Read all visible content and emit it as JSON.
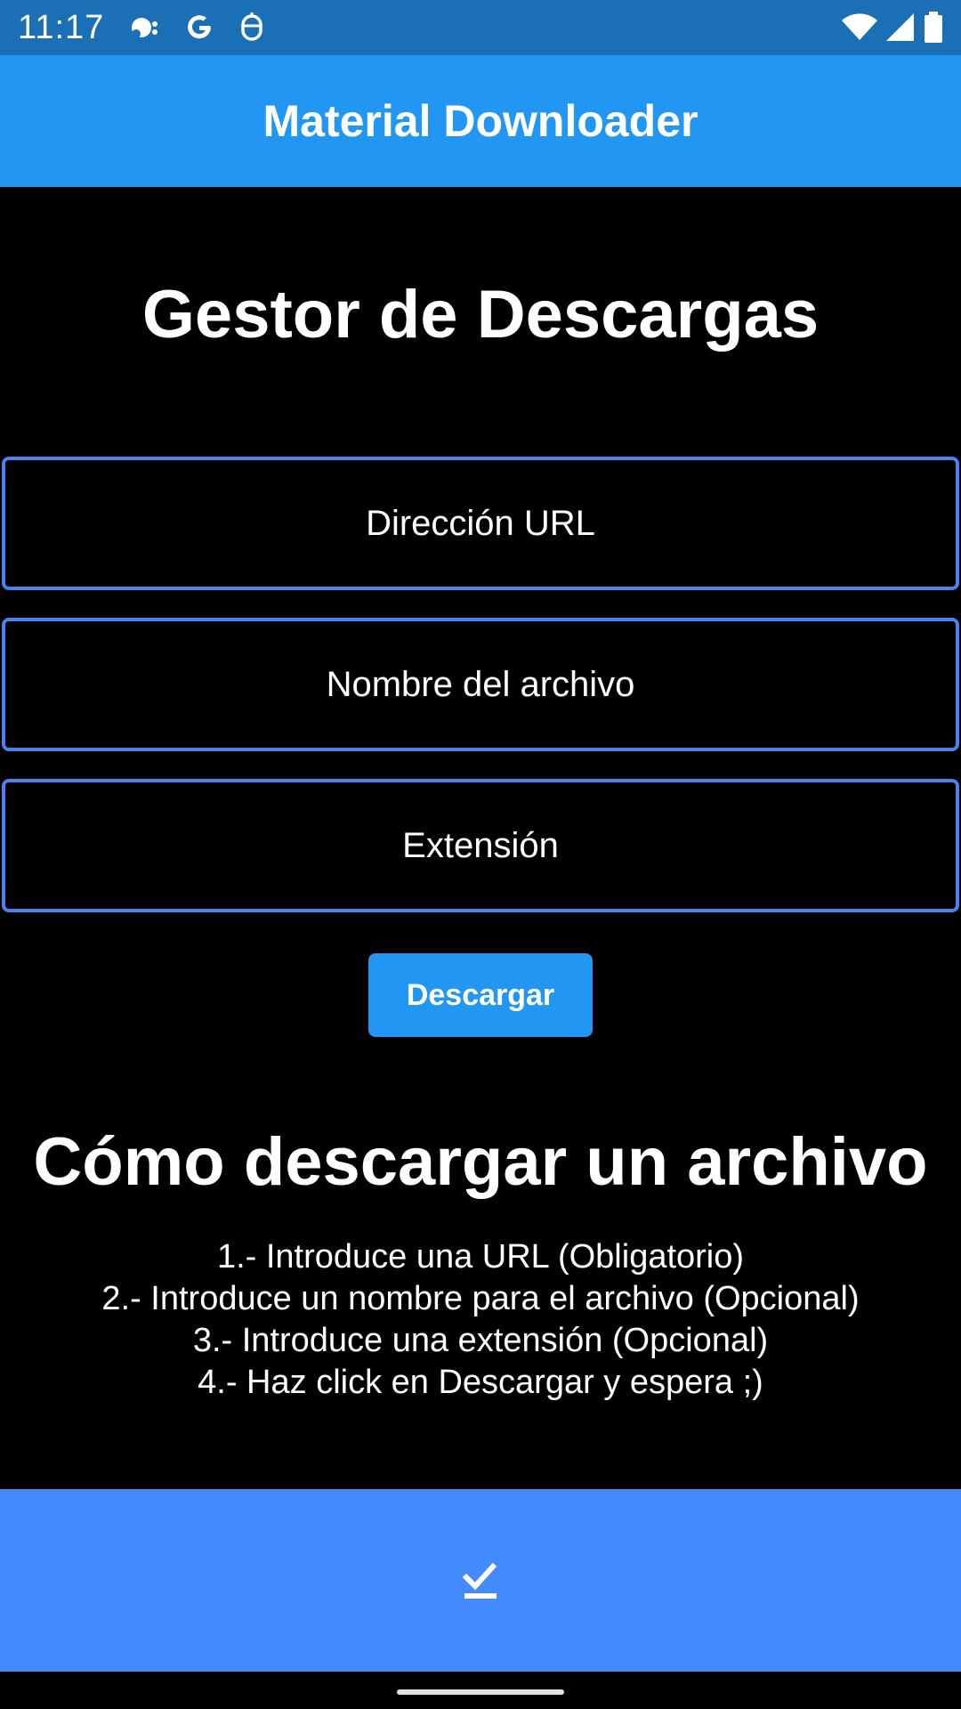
{
  "status_bar": {
    "time": "11:17",
    "left_icons": [
      "notification-icon",
      "google-icon",
      "assistant-icon"
    ],
    "right_icons": [
      "wifi-icon",
      "signal-icon",
      "battery-icon"
    ]
  },
  "app_bar": {
    "title": "Material Downloader",
    "color": "#2196f3"
  },
  "main": {
    "title": "Gestor de Descargas",
    "fields": {
      "url_placeholder": "Dirección URL",
      "name_placeholder": "Nombre del archivo",
      "extension_placeholder": "Extensión",
      "border_color": "#4a82f0"
    },
    "download_label": "Descargar"
  },
  "howto": {
    "title": "Cómo descargar un archivo",
    "steps": [
      "1.- Introduce una URL (Obligatorio)",
      "2.- Introduce un nombre para el archivo (Opcional)",
      "3.- Introduce una extensión (Opcional)",
      "4.- Haz click en Descargar y espera ;)"
    ]
  },
  "bottom_bar": {
    "icon": "download-done-icon",
    "color": "#448aff"
  }
}
